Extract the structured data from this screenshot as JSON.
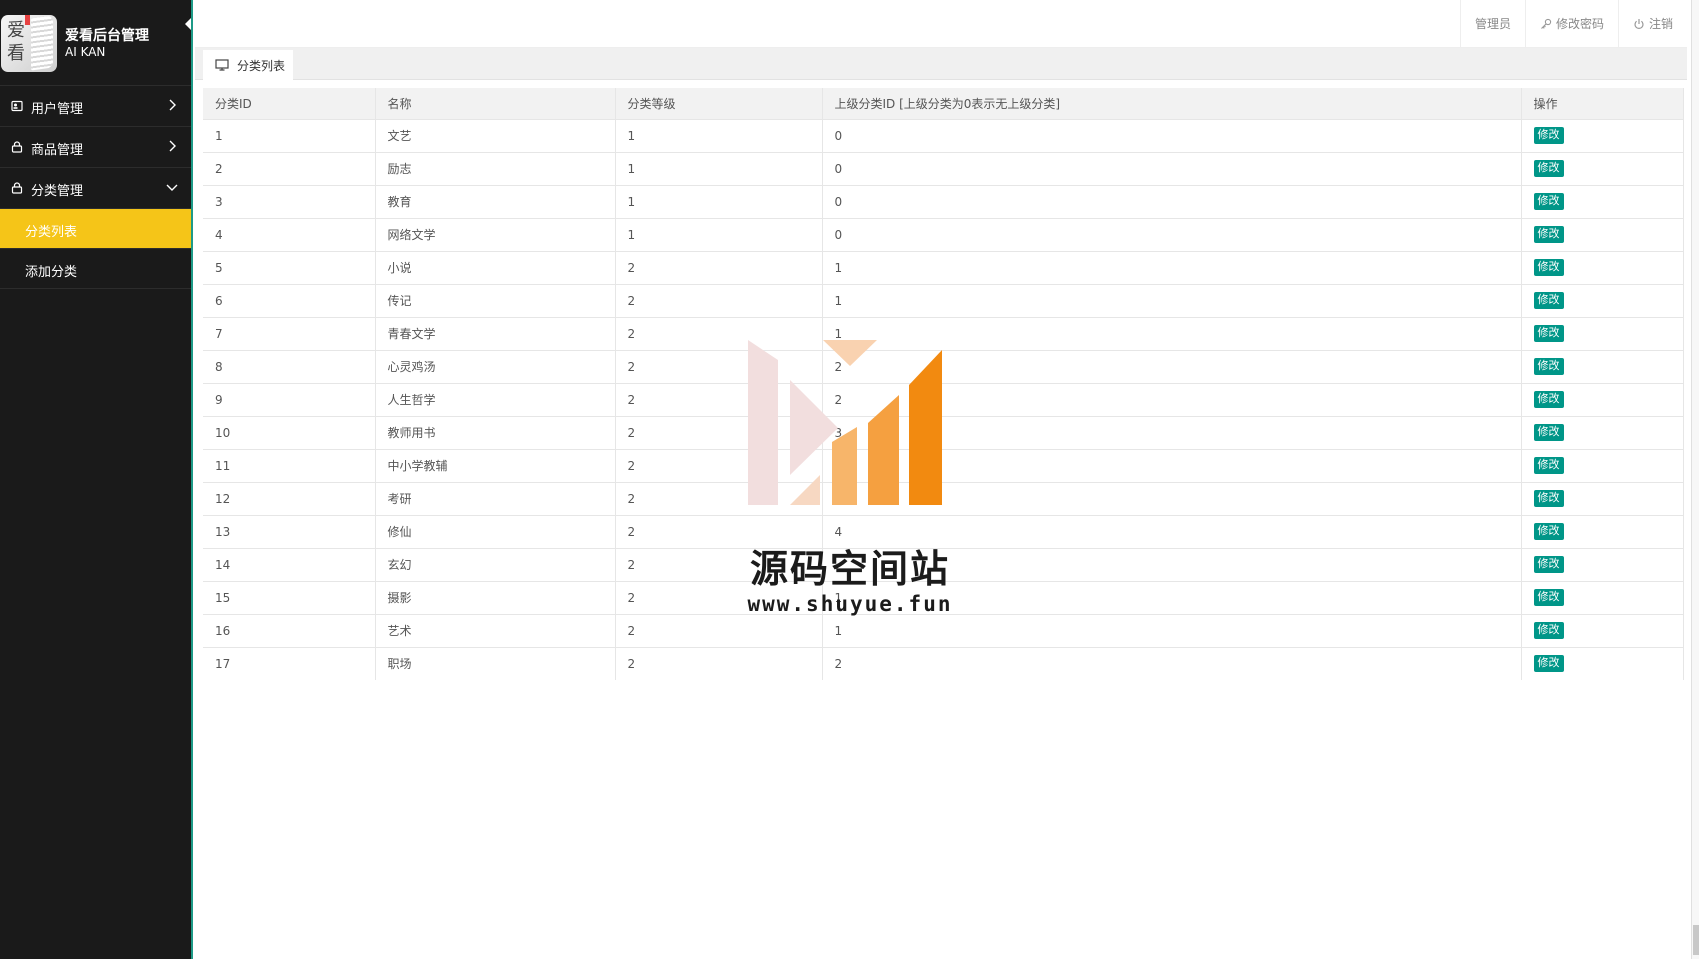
{
  "brand": {
    "logo_chars": [
      "爱",
      "看"
    ],
    "title": "爱看后台管理",
    "subtitle": "AI KAN"
  },
  "sidebar": {
    "items": [
      {
        "label": "用户管理",
        "icon": "user-card-icon",
        "expanded": false
      },
      {
        "label": "商品管理",
        "icon": "lock-icon",
        "expanded": false
      },
      {
        "label": "分类管理",
        "icon": "lock-icon",
        "expanded": true
      }
    ],
    "subitems": [
      {
        "label": "分类列表",
        "active": true
      },
      {
        "label": "添加分类",
        "active": false
      }
    ]
  },
  "header": {
    "admin": "管理员",
    "change_password": "修改密码",
    "logout": "注销"
  },
  "tab": {
    "label": "分类列表",
    "icon": "monitor-icon"
  },
  "table": {
    "columns": [
      "分类ID",
      "名称",
      "分类等级",
      "上级分类ID [上级分类为0表示无上级分类]",
      "操作"
    ],
    "edit_label": "修改",
    "rows": [
      {
        "id": "1",
        "name": "文艺",
        "level": "1",
        "parent": "0"
      },
      {
        "id": "2",
        "name": "励志",
        "level": "1",
        "parent": "0"
      },
      {
        "id": "3",
        "name": "教育",
        "level": "1",
        "parent": "0"
      },
      {
        "id": "4",
        "name": "网络文学",
        "level": "1",
        "parent": "0"
      },
      {
        "id": "5",
        "name": "小说",
        "level": "2",
        "parent": "1"
      },
      {
        "id": "6",
        "name": "传记",
        "level": "2",
        "parent": "1"
      },
      {
        "id": "7",
        "name": "青春文学",
        "level": "2",
        "parent": "1"
      },
      {
        "id": "8",
        "name": "心灵鸡汤",
        "level": "2",
        "parent": "2"
      },
      {
        "id": "9",
        "name": "人生哲学",
        "level": "2",
        "parent": "2"
      },
      {
        "id": "10",
        "name": "教师用书",
        "level": "2",
        "parent": "3"
      },
      {
        "id": "11",
        "name": "中小学教辅",
        "level": "2",
        "parent": ""
      },
      {
        "id": "12",
        "name": "考研",
        "level": "2",
        "parent": ""
      },
      {
        "id": "13",
        "name": "修仙",
        "level": "2",
        "parent": "4"
      },
      {
        "id": "14",
        "name": "玄幻",
        "level": "2",
        "parent": ""
      },
      {
        "id": "15",
        "name": "摄影",
        "level": "2",
        "parent": "1"
      },
      {
        "id": "16",
        "name": "艺术",
        "level": "2",
        "parent": "1"
      },
      {
        "id": "17",
        "name": "职场",
        "level": "2",
        "parent": "2"
      }
    ]
  },
  "watermark": {
    "title": "源码空间站",
    "url": "www.shuyue.fun"
  },
  "colors": {
    "sidebar_bg": "#1a1a1a",
    "active_item": "#f5c518",
    "edit_button": "#009688",
    "accent_border": "#1e9a87"
  }
}
